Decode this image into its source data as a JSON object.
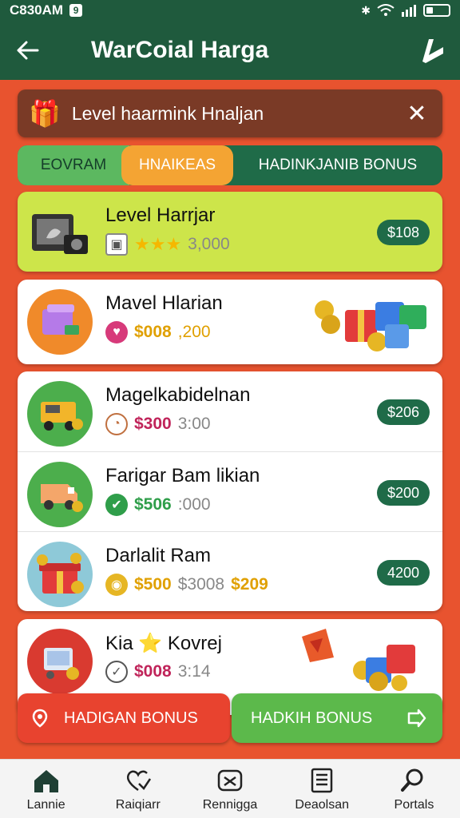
{
  "status_bar": {
    "time": "C830AM",
    "notif": "9"
  },
  "app_bar": {
    "title": "WarCoial Harga"
  },
  "banner": {
    "text": "Level haarmink Hnaljan",
    "close": "✕"
  },
  "tabs": [
    {
      "label": "EOVRAM"
    },
    {
      "label": "HNAIKEAS"
    },
    {
      "label": "HADINKJANIB BONUS"
    }
  ],
  "items": [
    {
      "title": "Level Harrjar",
      "rating_stars": "★★★",
      "price": "3,000",
      "badge": "$108"
    },
    {
      "title": "Mavel Hlarian",
      "price": "$008",
      "price_extra": ",200"
    },
    {
      "title": "Magelkabidelnan",
      "price": "$300",
      "price_old": "3:00",
      "badge": "$206"
    },
    {
      "title": "Farigar Bam likian",
      "price": "$506",
      "price_old": ":000",
      "badge": "$200"
    },
    {
      "title": "Darlalit Ram",
      "price": "$500",
      "price_old": "$3008",
      "price_extra": "$209",
      "badge": "4200"
    },
    {
      "title": "Kia ⭐ Kovrej",
      "price": "$008",
      "price_old": "3:14"
    }
  ],
  "actions": {
    "left_label": "HADIGAN BONUS",
    "right_label": "HADKIH BONUS"
  },
  "nav": [
    {
      "label": "Lannie"
    },
    {
      "label": "Raiqiarr"
    },
    {
      "label": "Rennigga"
    },
    {
      "label": "Deaolsan"
    },
    {
      "label": "Portals"
    }
  ],
  "colors": {
    "brand_dark": "#1f5a3d",
    "accent_orange": "#f4a433",
    "bg_red": "#e8532f",
    "highlight": "#cde54a"
  }
}
